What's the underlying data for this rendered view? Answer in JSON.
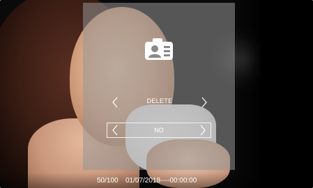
{
  "menu": {
    "icon": "camera-user-icon",
    "option_label": "DELETE",
    "value_label": "NO"
  },
  "status": {
    "index": "50/100",
    "timestamp": "01/07/2018----00:00:00"
  },
  "colors": {
    "panel": "#969696",
    "text": "#ffffff"
  }
}
